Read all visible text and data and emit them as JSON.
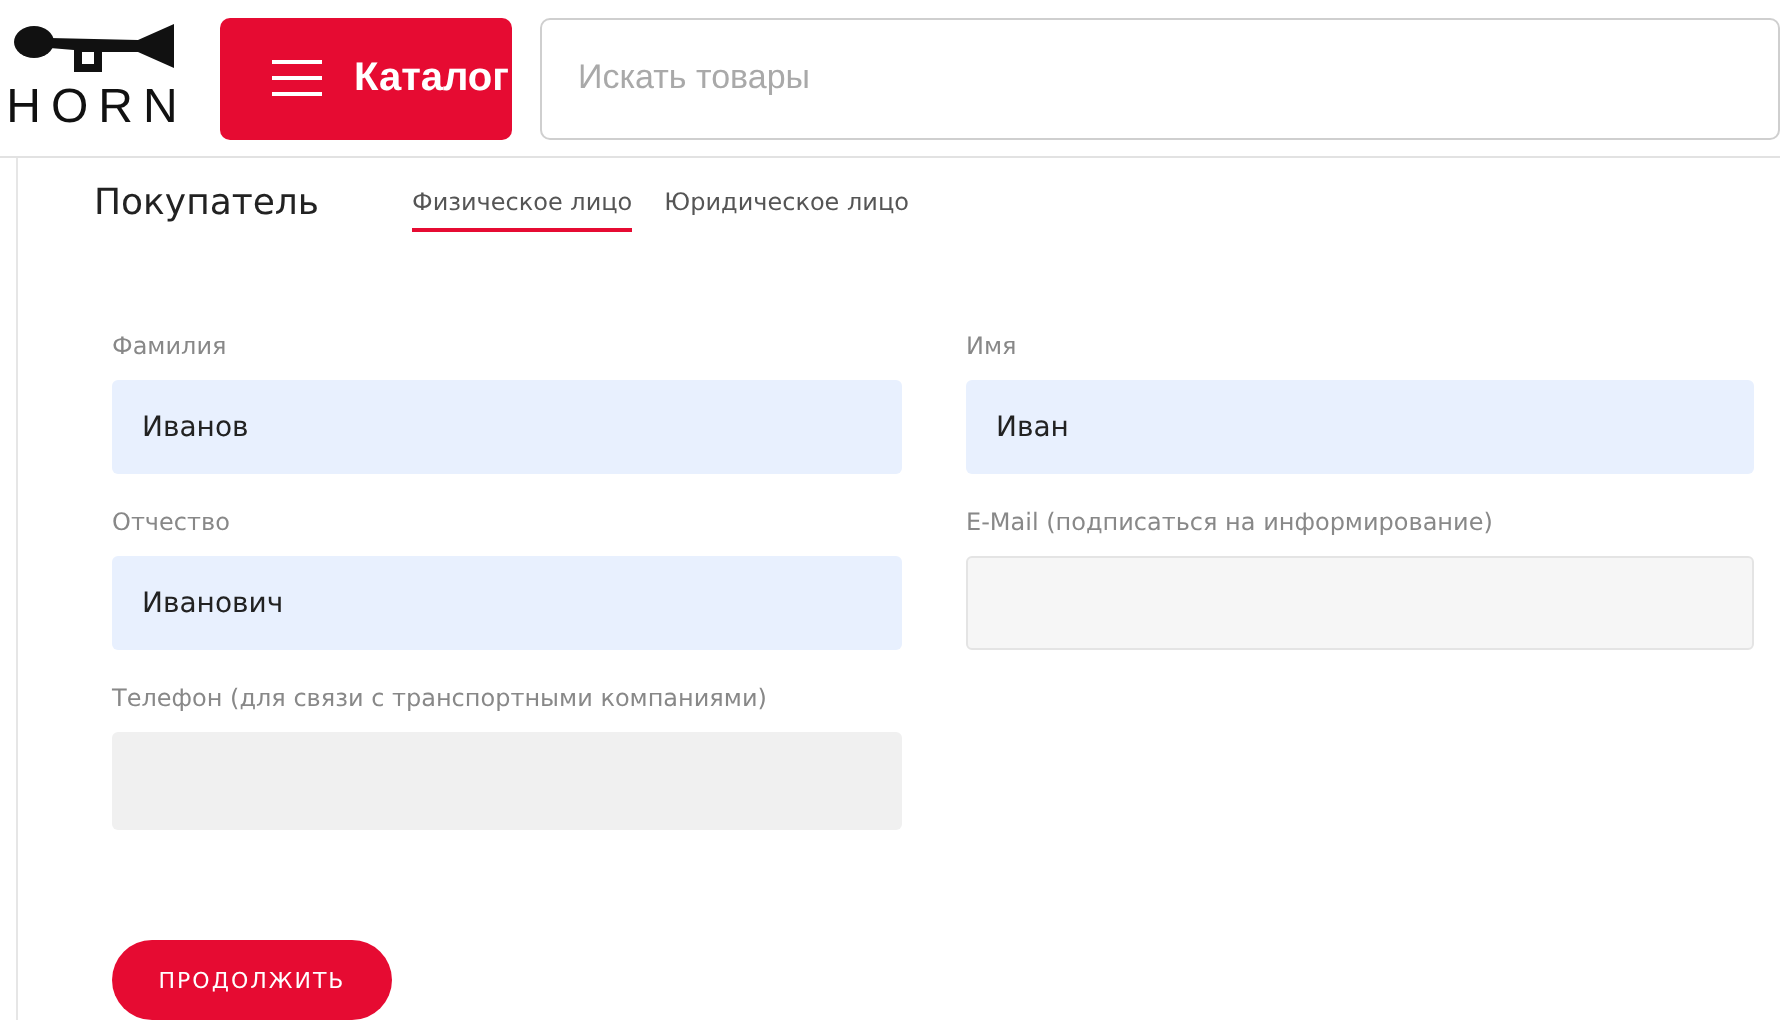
{
  "header": {
    "logo_text": "HORN",
    "catalog_button": "Каталог",
    "search": {
      "placeholder": "Искать товары"
    }
  },
  "section": {
    "title": "Покупатель",
    "tabs": [
      {
        "label": "Физическое лицо",
        "selected": true
      },
      {
        "label": "Юридическое лицо",
        "selected": false
      }
    ]
  },
  "fields": [
    {
      "label": "Фамилия",
      "value": "Иванов",
      "kind": "autofilled"
    },
    {
      "label": "Имя",
      "value": "Иван",
      "kind": "autofilled"
    },
    {
      "label": "Отчество",
      "value": "Иванович",
      "kind": "autofilled"
    },
    {
      "label": "E-Mail (подписаться на информирование)",
      "kind": "bordered"
    },
    {
      "label": "Телефон (для связи с транспортными компаниями)",
      "kind": "plain"
    }
  ],
  "submit_button": "ПРОДОЛЖИТЬ"
}
